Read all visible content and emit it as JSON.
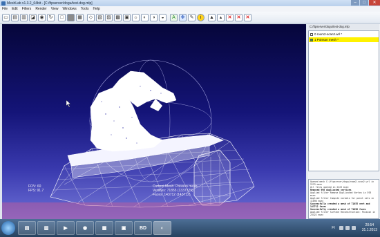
{
  "window": {
    "title": "MeshLab v1.3.2_64bit - [C:/ftpserver/dogu/test-dog.mlp]",
    "min_label": "–",
    "max_label": "□",
    "close_label": "✕"
  },
  "menu": [
    "File",
    "Edit",
    "Filters",
    "Render",
    "View",
    "Windows",
    "Tools",
    "Help"
  ],
  "toolbar_icons": [
    "new-project",
    "open-project",
    "import-mesh",
    "export-mesh",
    "snapshot",
    "reload",
    "bounding-box",
    "points",
    "wireframe",
    "hidden-lines",
    "flat-lines",
    "flat",
    "smooth",
    "texture",
    "light-on",
    "fancy-light",
    "double-side",
    "color-per-vertex",
    "align",
    "manipulator",
    "measure",
    "info",
    "select-faces",
    "select-vertices",
    "delete-selected",
    "delete-vertices",
    "paint"
  ],
  "viewport": {
    "fov_label": "FOV: 60",
    "fps_label": "FPS:   91.7",
    "current_mesh": "Current Mesh: Poisson mesh",
    "vertices": "Vertices: 71855 (1337329)",
    "faces": "Faces: 143712 (143712)"
  },
  "layers_panel": {
    "path": "C:/ftpserver/dogu/test-dog.mlp",
    "layers": [
      {
        "index": "0",
        "name": "room2-scan2.wrl *",
        "selected": false
      },
      {
        "index": "1",
        "name": "Poisson mesh *",
        "selected": true
      }
    ]
  },
  "log": [
    {
      "text": "Opened mesh C:/ftpserver/dogu/room2-scan2.wrl in",
      "bold": false
    },
    {
      "text": "2223 msec",
      "bold": false
    },
    {
      "text": "All files opened in 2223 msec",
      "bold": false
    },
    {
      "text": "Removed 996 duplicated vertices",
      "bold": true
    },
    {
      "text": "Applied filter Remove Duplicated Vertex in 593",
      "bold": false
    },
    {
      "text": "msec",
      "bold": false
    },
    {
      "text": "Applied filter Compute normals for point sets in",
      "bold": false
    },
    {
      "text": "11898 msec",
      "bold": false
    },
    {
      "text": "Successfully created a mesh of 71855 vert and",
      "bold": true
    },
    {
      "text": "143712 faces",
      "bold": true
    },
    {
      "text": "Successfully created a mesh of 71856 faces",
      "bold": true
    },
    {
      "text": "Applied filter Surface Reconstruction: Poisson in",
      "bold": false
    },
    {
      "text": "23422 msec",
      "bold": false
    }
  ],
  "taskbar": {
    "apps": [
      "windows-explorer",
      "file-manager",
      "media-player",
      "chrome",
      "office",
      "remote-desktop",
      "bd-tool",
      "meshlab"
    ],
    "bd_label": "BD",
    "lang": "FI",
    "time": "20:54",
    "date": "31.1.2013"
  }
}
